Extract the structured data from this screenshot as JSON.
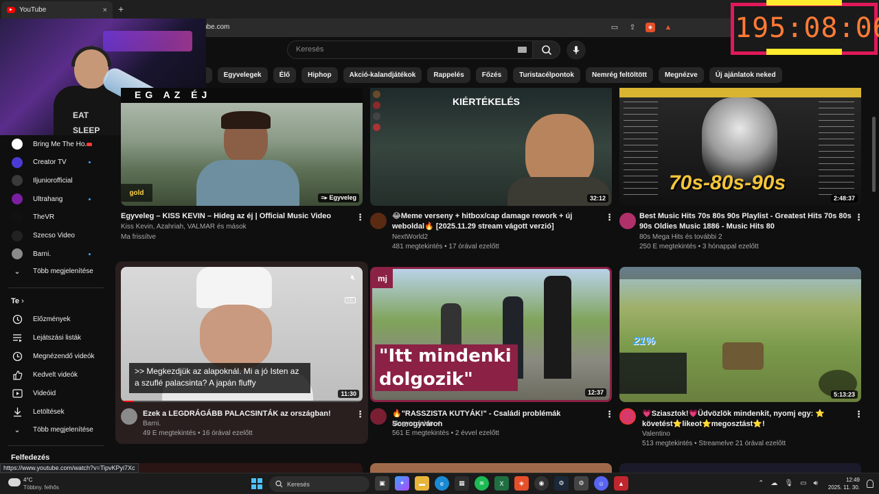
{
  "browser": {
    "tab_title": "YouTube",
    "tab_close": "×",
    "new_tab": "+",
    "url": "ube.com",
    "brave_badge": "6",
    "alert_badge": "1"
  },
  "overlay": {
    "timer": "195:08:06",
    "shirt_line1": "EAT",
    "shirt_line2": "SLEEP"
  },
  "search": {
    "placeholder": "Keresés"
  },
  "chips": [
    "k",
    "Egyvelegek",
    "Élő",
    "Hiphop",
    "Akció-kalandjátékok",
    "Rappelés",
    "Főzés",
    "Turistacélpontok",
    "Nemrég feltöltött",
    "Megnézve",
    "Új ajánlatok neked"
  ],
  "sidebar": {
    "subscriptions": [
      {
        "label": "Bring Me The Ho...",
        "live": true,
        "color": "#ffffff"
      },
      {
        "label": "Creator TV",
        "dot": true,
        "color": "#4a3bd6"
      },
      {
        "label": "Iljuniorofficial",
        "dot": false,
        "color": "#3a3a3a"
      },
      {
        "label": "Ultrahang",
        "dot": true,
        "color": "#7a1fa2"
      },
      {
        "label": "TheVR",
        "dot": false,
        "color": "#111111"
      },
      {
        "label": "Szecso Video",
        "dot": false,
        "color": "#222222"
      },
      {
        "label": "Barni.",
        "dot": true,
        "color": "#8a8a8a"
      }
    ],
    "show_more_1": "Több megjelenítése",
    "you_heading": "Te",
    "you_items": [
      "Előzmények",
      "Lejátszási listák",
      "Megnézendő videók",
      "Kedvelt videók",
      "Videóid",
      "Letöltések"
    ],
    "show_more_2": "Több megjelenítése",
    "explore_heading": "Felfedezés"
  },
  "videos": [
    {
      "thumb_brand": "gold",
      "thumb_badge": "Egyveleg",
      "thumb_text": "EG AZ ÉJ",
      "title": "Egyveleg – KISS KEVIN – Hideg az éj | Official Music Video",
      "channel": "Kiss Kevin, Azahriah, VALMAR és mások",
      "meta": "Ma frissítve",
      "avatar_color": "#000000"
    },
    {
      "thumb_text": "KIÉRTÉKELÉS",
      "duration": "32:12",
      "title": "😂Meme verseny + hitbox/cap damage rework + új weboldal🔥 [2025.11.29 stream vágott verzió]",
      "channel": "NextWorld2",
      "meta": "481 megtekintés • 17 órával ezelőtt",
      "avatar_color": "#5a2a12"
    },
    {
      "thumb_text": "70s-80s-90s",
      "duration": "2:48:37",
      "title": "Best Music Hits 70s 80s 90s Playlist - Greatest Hits 70s 80s 90s Oldies Music 1886 - Music Hits 80",
      "channel": "80s Mega Hits és további 2",
      "meta": "250 E megtekintés • 3 hónappal ezelőtt",
      "avatar_color": "#b0306a"
    },
    {
      "caption": ">> Megkezdjük az alapoknál. Mi a jó Isten az a szuflé palacsinta? A japán fluffy",
      "cc": "CC",
      "duration": "11:30",
      "title": "Ezek a LEGDRÁGÁBB PALACSINTÁK az országban!",
      "channel": "Barni.",
      "meta": "49 E megtekintés • 16 órával ezelőtt",
      "avatar_color": "#8a8a8a"
    },
    {
      "brand": "mj",
      "quote": "\"Itt mindenki dolgozik\"",
      "duration": "12:37",
      "title": "🔥\"RASSZISTA KUTYÁK!\" - Családi problémák Somogyváron",
      "channel": "Magyar Jelen",
      "meta": "561 E megtekintés • 2 évvel ezelőtt",
      "avatar_color": "#7a1f33"
    },
    {
      "percent": "21%",
      "duration": "5:13:23",
      "title": "💗Sziasztok!💗Üdvözlök mindenkit, nyomj egy: ⭐ követést⭐likeot⭐megosztást⭐!",
      "channel": "Valentino",
      "meta": "513 megtekintés • Streamelve 21 órával ezelőtt",
      "avatar_color": "#d63a6a"
    }
  ],
  "status_url": "https://www.youtube.com/watch?v=TipvKPyi7Xc",
  "taskbar": {
    "temp": "4°C",
    "condition": "Többny. felhős",
    "search": "Keresés",
    "time": "12:49",
    "date": "2025. 11. 30."
  }
}
